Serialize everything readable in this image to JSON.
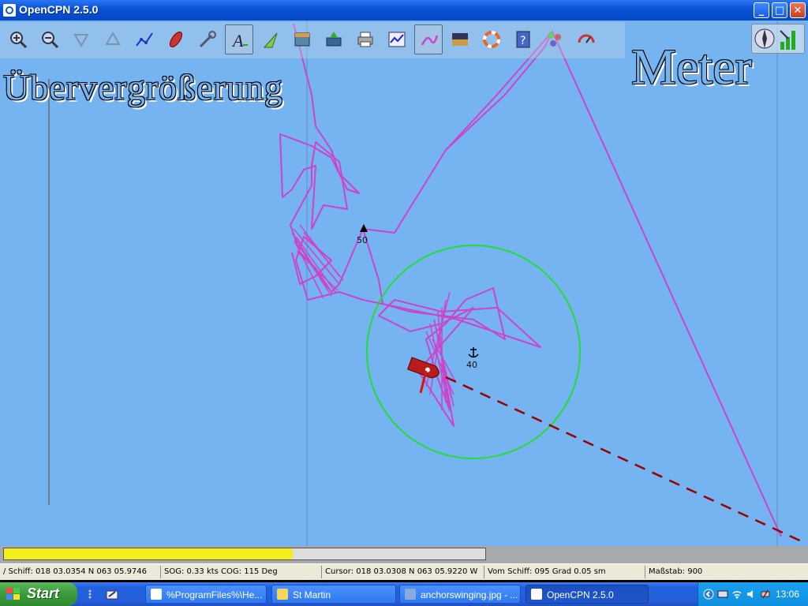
{
  "window": {
    "title": "OpenCPN 2.5.0"
  },
  "window_buttons": {
    "minimize": "_",
    "maximize": "□",
    "close": "✕"
  },
  "toolbar": {
    "tools": [
      {
        "name": "zoom-in-icon"
      },
      {
        "name": "zoom-out-icon"
      },
      {
        "name": "scale-in-icon"
      },
      {
        "name": "scale-out-icon"
      },
      {
        "name": "route-icon"
      },
      {
        "name": "follow-ship-icon"
      },
      {
        "name": "settings-icon"
      },
      {
        "name": "text-icon",
        "active": true
      },
      {
        "name": "current-icon"
      },
      {
        "name": "tide-icon"
      },
      {
        "name": "chart-info-icon"
      },
      {
        "name": "print-icon"
      },
      {
        "name": "route-manager-icon"
      },
      {
        "name": "track-icon",
        "active": true
      },
      {
        "name": "color-scheme-icon"
      },
      {
        "name": "mob-icon"
      },
      {
        "name": "help-icon"
      },
      {
        "name": "ais-icon"
      },
      {
        "name": "gps-icon"
      }
    ]
  },
  "chart": {
    "magnification_text": "Übervergrößerung",
    "units_text": "Meter",
    "depth_labels": [
      "50",
      "40"
    ]
  },
  "progress": {
    "fraction": 0.6
  },
  "status": {
    "ship": "/ Schiff: 018 03.0354 N   063 05.9746",
    "sog_cog": "SOG:  0.33 kts  COG:   115 Deg",
    "cursor": "Cursor: 018 03.0308 N 063 05.9220 W",
    "from_ship": "Vom Schiff: 095 Grad    0.05 sm",
    "scale": "Maßstab:       900"
  },
  "taskbar": {
    "start_label": "Start",
    "tasks": [
      {
        "label": "%ProgramFiles%\\He...",
        "active": false
      },
      {
        "label": "St Martin",
        "active": false
      },
      {
        "label": "anchorswinging.jpg - ...",
        "active": false
      },
      {
        "label": "OpenCPN 2.5.0",
        "active": true
      }
    ],
    "clock": "13:06"
  },
  "colors": {
    "sea": "#75b4f0",
    "track": "#cc44cc",
    "anchor_circle": "#22dd33",
    "heading_line": "#990000",
    "progress": "#f3ee1a"
  }
}
